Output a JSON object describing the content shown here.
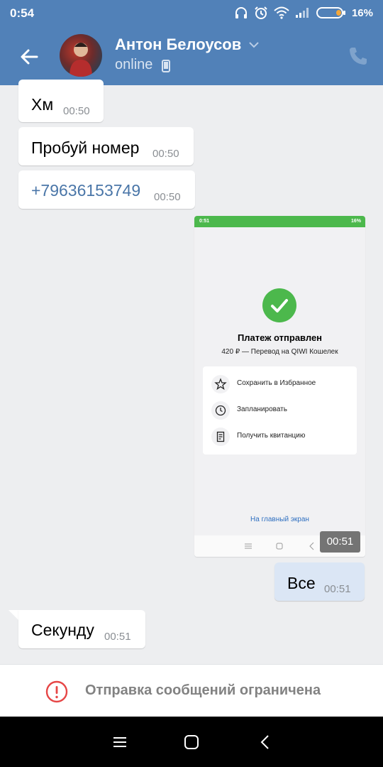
{
  "status_bar": {
    "time": "0:54",
    "battery": "16%"
  },
  "header": {
    "contact_name": "Антон Белоусов",
    "presence": "online"
  },
  "messages": [
    {
      "text": "Хм",
      "time": "00:50"
    },
    {
      "text": "Пробуй номер",
      "time": "00:50"
    },
    {
      "text": "+79636153749",
      "time": "00:50"
    },
    {
      "text": "Все",
      "time": "00:51"
    },
    {
      "text": "Секунду",
      "time": "00:51"
    }
  ],
  "attachment": {
    "time": "00:51",
    "status_time": "0:51",
    "status_battery": "16%",
    "title": "Платеж отправлен",
    "subtitle": "420 ₽ — Перевод на QIWI Кошелек",
    "actions": [
      {
        "label": "Сохранить в Избранное",
        "icon": "star-icon"
      },
      {
        "label": "Запланировать",
        "icon": "clock-icon"
      },
      {
        "label": "Получить квитанцию",
        "icon": "receipt-icon"
      }
    ],
    "home_link": "На главный экран"
  },
  "restriction": {
    "text": "Отправка сообщений ограничена"
  },
  "colors": {
    "header": "#5181b8",
    "background": "#edeef0",
    "outgoing_bubble": "#dbe6f5",
    "link": "#4a76a8",
    "success": "#4cb84c",
    "warning": "#e64646"
  }
}
